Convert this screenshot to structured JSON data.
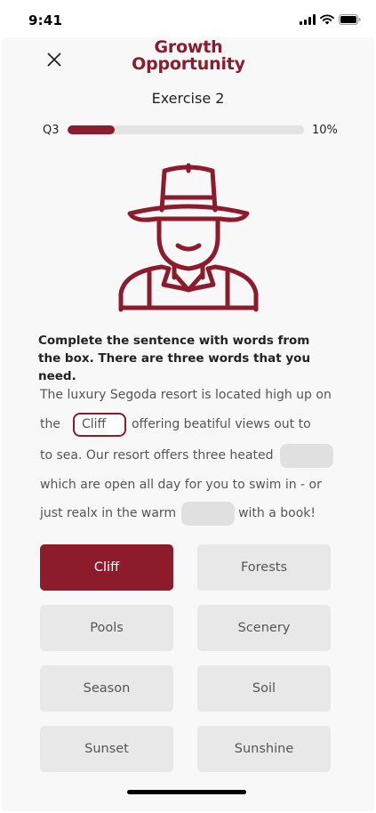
{
  "status_bar": {
    "time": "9:41"
  },
  "header": {
    "brand_line1": "Growth",
    "brand_line2": "Opportunity",
    "exercise_title": "Exercise 2"
  },
  "progress": {
    "label": "Q3",
    "percent_text": "10%",
    "fraction": 0.2
  },
  "instruction": "Complete the sentence with words from the box. There are three words that you need.",
  "passage": {
    "line1": "The luxury Segoda resort is located high up on",
    "line2_before": "the",
    "blank1_value": "Cliff",
    "line2_after": "offering beatiful views out to",
    "line3_before": "to sea. Our resort offers three heated",
    "line4": "which are open all day for you to swim in - or",
    "line5_before": "just realx in the warm",
    "line5_after": "with a book!"
  },
  "words": [
    {
      "label": "Cliff",
      "selected": true
    },
    {
      "label": "Forests",
      "selected": false
    },
    {
      "label": "Pools",
      "selected": false
    },
    {
      "label": "Scenery",
      "selected": false
    },
    {
      "label": "Season",
      "selected": false
    },
    {
      "label": "Soil",
      "selected": false
    },
    {
      "label": "Sunset",
      "selected": false
    },
    {
      "label": "Sunshine",
      "selected": false
    }
  ],
  "colors": {
    "accent": "#8c1c2c",
    "option_bg": "#e8e8e8",
    "blank_bg": "#e0e0e0"
  },
  "icons": {
    "close": "close-icon",
    "illustration": "cowboy-avatar-icon",
    "signal": "signal-icon",
    "wifi": "wifi-icon",
    "battery": "battery-icon"
  }
}
